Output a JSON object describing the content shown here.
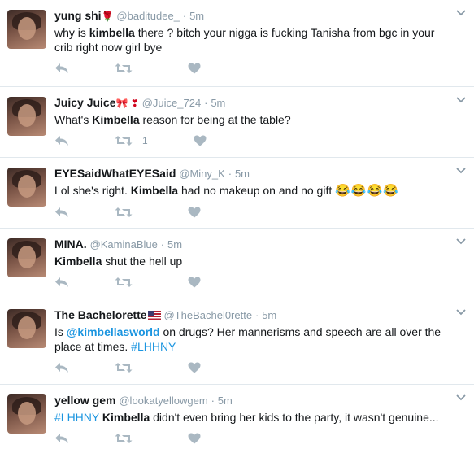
{
  "tweets": [
    {
      "name": "yung shi",
      "emoji": "🌹",
      "handle": "@baditudee_",
      "sep": "·",
      "time": "5m",
      "text": [
        {
          "t": "why is ",
          "style": "normal"
        },
        {
          "t": "kimbella",
          "style": "bold"
        },
        {
          "t": " there ? bitch your nigga is fucking Tanisha from bgc in your crib right now girl bye",
          "style": "normal"
        }
      ],
      "retweet_count": ""
    },
    {
      "name": "Juicy Juice",
      "emoji": "🎀 ❣",
      "handle": "@Juice_724",
      "sep": "·",
      "time": "5m",
      "text": [
        {
          "t": "What's ",
          "style": "normal"
        },
        {
          "t": "Kimbella",
          "style": "bold"
        },
        {
          "t": " reason for being at the table?",
          "style": "normal"
        }
      ],
      "retweet_count": "1"
    },
    {
      "name": "EYESaidWhatEYESaid",
      "emoji": "",
      "handle": "@Miny_K",
      "sep": "·",
      "time": "5m",
      "text": [
        {
          "t": "Lol she's right. ",
          "style": "normal"
        },
        {
          "t": "Kimbella",
          "style": "bold"
        },
        {
          "t": " had no makeup on and no gift ",
          "style": "normal"
        },
        {
          "t": "😂😂😂😂",
          "style": "emoji"
        }
      ],
      "retweet_count": ""
    },
    {
      "name": "MINA.",
      "emoji": "",
      "handle": "@KaminaBlue",
      "sep": "·",
      "time": "5m",
      "text": [
        {
          "t": "Kimbella",
          "style": "bold"
        },
        {
          "t": " shut the hell up",
          "style": "normal"
        }
      ],
      "retweet_count": ""
    },
    {
      "name": "The Bachelorette",
      "emoji": "flag",
      "handle": "@TheBachel0rette",
      "sep": "·",
      "time": "5m",
      "text": [
        {
          "t": "Is ",
          "style": "normal"
        },
        {
          "t": "@kimbellasworld",
          "style": "link-bold"
        },
        {
          "t": " on drugs? Her mannerisms and speech are all over the place at times. ",
          "style": "normal"
        },
        {
          "t": "#LHHNY",
          "style": "link"
        }
      ],
      "retweet_count": ""
    },
    {
      "name": "yellow gem",
      "emoji": "",
      "handle": "@lookatyellowgem",
      "sep": "·",
      "time": "5m",
      "text": [
        {
          "t": "#LHHNY",
          "style": "link"
        },
        {
          "t": " ",
          "style": "normal"
        },
        {
          "t": "Kimbella",
          "style": "bold"
        },
        {
          "t": " didn't even bring her kids to the party, it wasn't genuine...",
          "style": "normal"
        }
      ],
      "retweet_count": ""
    }
  ],
  "icons": {
    "reply": "reply-icon",
    "retweet": "retweet-icon",
    "like": "heart-icon",
    "more": "chevron-down-icon"
  },
  "colors": {
    "link": "#1b95e0",
    "muted": "#8899a6",
    "icon": "#aab8c2",
    "border": "#e1e8ed"
  }
}
